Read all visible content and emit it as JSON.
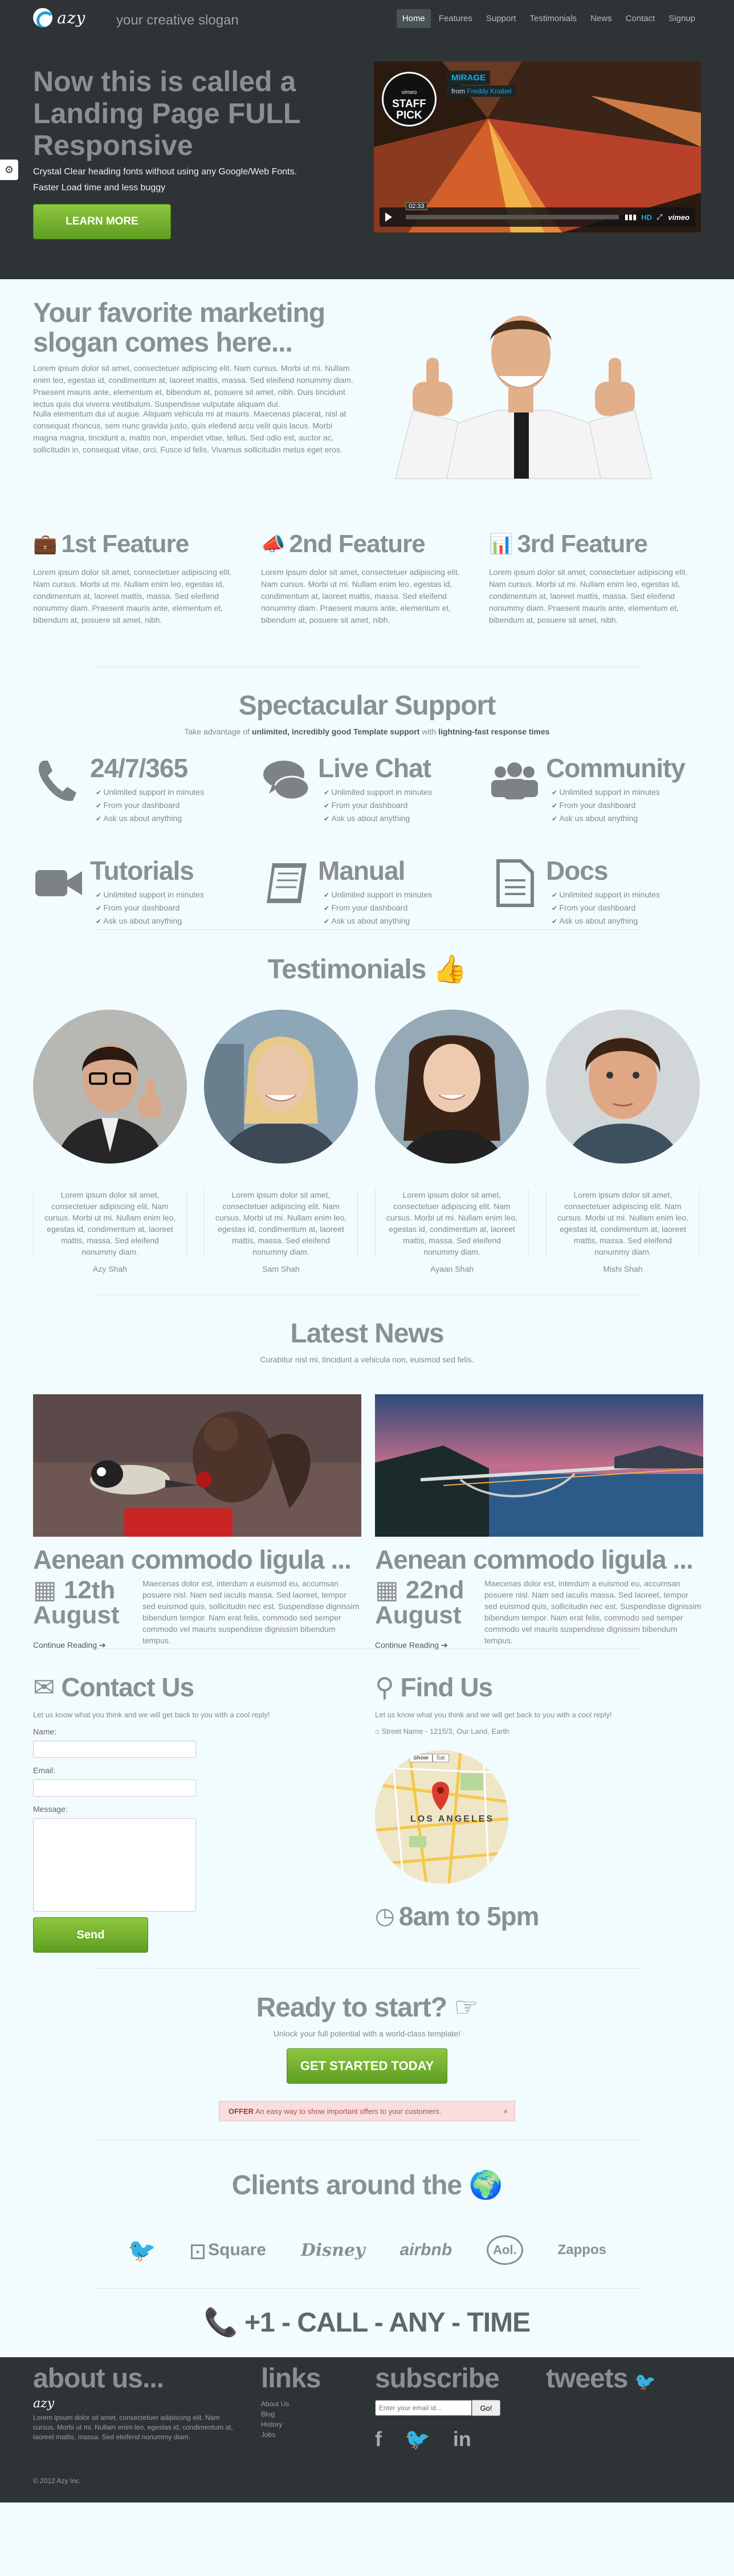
{
  "header": {
    "logo_text": "azy",
    "slogan": "your creative slogan",
    "nav": [
      "Home",
      "Features",
      "Support",
      "Testimonials",
      "News",
      "Contact",
      "Signup"
    ],
    "hero_title": "Now this is called a Landing Page FULL Responsive",
    "hero_sub1": "Crystal Clear heading fonts without using any Google/Web Fonts.",
    "hero_sub2": "Faster Load time and less buggy",
    "learn_more": "LEARN MORE",
    "video": {
      "badge_line1": "STAFF",
      "badge_line2": "PICK",
      "badge_top": "vimeo",
      "title": "MIRAGE",
      "from": "from",
      "author": "Freddy Knabel",
      "time": "02:33",
      "hd": "HD",
      "brand": "vimeo"
    }
  },
  "marketing": {
    "title": "Your favorite marketing slogan comes here...",
    "p1": "Lorem ipsum dolor sit amet, consectetuer adipiscing elit. Nam cursus. Morbi ut mi. Nullam enim leo, egestas id, condimentum at, laoreet mattis, massa. Sed eleifend nonummy diam. Praesent mauris ante, elementum et, bibendum at, posuere sit amet, nibh. Duis tincidunt lectus quis dui viverra vestibulum. Suspendisse vulputate aliquam dui.",
    "p2": "Nulla elementum dui ut augue. Aliquam vehicula mi at mauris. Maecenas placerat, nisl at consequat rhoncus, sem nunc gravida justo, quis eleifend arcu velit quis lacus. Morbi magna magna, tincidunt a, mattis non, imperdiet vitae, tellus. Sed odio est, auctor ac, sollicitudin in, consequat vitae, orci. Fusce id felis. Vivamus sollicitudin metus eget eros."
  },
  "features": [
    {
      "icon": "briefcase-icon",
      "title": "1st Feature",
      "text": "Lorem ipsum dolor sit amet, consectetuer adipiscing elit. Nam cursus. Morbi ut mi. Nullam enim leo, egestas id, condimentum at, laoreet mattis, massa. Sed eleifend nonummy diam. Praesent mauris ante, elementum et, bibendum at, posuere sit amet, nibh."
    },
    {
      "icon": "bullhorn-icon",
      "title": "2nd Feature",
      "text": "Lorem ipsum dolor sit amet, consectetuer adipiscing elit. Nam cursus. Morbi ut mi. Nullam enim leo, egestas id, condimentum at, laoreet mattis, massa. Sed eleifend nonummy diam. Praesent mauris ante, elementum et, bibendum at, posuere sit amet, nibh."
    },
    {
      "icon": "bar-chart-icon",
      "title": "3rd Feature",
      "text": "Lorem ipsum dolor sit amet, consectetuer adipiscing elit. Nam cursus. Morbi ut mi. Nullam enim leo, egestas id, condimentum at, laoreet mattis, massa. Sed eleifend nonummy diam. Praesent mauris ante, elementum et, bibendum at, posuere sit amet, nibh."
    }
  ],
  "support": {
    "title": "Spectacular Support",
    "tag_pre": "Take advantage of ",
    "tag_b1": "unlimited, incredibly good Template support",
    "tag_mid": " with ",
    "tag_b2": "lightning-fast response times",
    "items": [
      {
        "icon": "phone-icon",
        "title": "24/7/365"
      },
      {
        "icon": "chat-icon",
        "title": "Live Chat"
      },
      {
        "icon": "group-icon",
        "title": "Community"
      },
      {
        "icon": "video-camera-icon",
        "title": "Tutorials"
      },
      {
        "icon": "book-icon",
        "title": "Manual"
      },
      {
        "icon": "document-icon",
        "title": "Docs"
      }
    ],
    "bullets": [
      "Unlimited support in minutes",
      "From your dashboard",
      "Ask us about anything"
    ]
  },
  "testimonials": {
    "title": "Testimonials",
    "quote": "Lorem ipsum dolor sit amet, consectetuer adipiscing elit. Nam cursus. Morbi ut mi. Nullam enim leo, egestas id, condimentum at, laoreet mattis, massa. Sed eleifend nonummy diam.",
    "names": [
      "Azy Shah",
      "Sam Shah",
      "Ayaan Shah",
      "Mishi Shah"
    ]
  },
  "news": {
    "title": "Latest News",
    "sub": "Curabitur nisl mi, tincidunt a vehicula non, euismod sed felis.",
    "items": [
      {
        "title": "Aenean commodo ligula ...",
        "day": "12th",
        "month": "August",
        "text": "Maecenas dolor est, interdum a euismod eu, accumsan posuere nisl. Nam sed iaculis massa. Sed laoreet, tempor sed euismod quis, sollicitudin nec est. Suspendisse dignissim bibendum tempor. Nam erat felis, commodo sed semper commodo vel mauris suspendisse dignissim bibendum tempus."
      },
      {
        "title": "Aenean commodo ligula ...",
        "day": "22nd",
        "month": "August",
        "text": "Maecenas dolor est, interdum a euismod eu, accumsan posuere nisl. Nam sed iaculis massa. Sed laoreet, tempor sed euismod quis, sollicitudin nec est. Suspendisse dignissim bibendum tempor. Nam erat felis, commodo sed semper commodo vel mauris suspendisse dignissim bibendum tempus."
      }
    ],
    "continue": "Continue Reading ➔"
  },
  "contact": {
    "title": "Contact Us",
    "sub": "Let us know what you think and we will get back to you with a cool reply!",
    "name_label": "Name:",
    "email_label": "Email:",
    "message_label": "Message:",
    "send": "Send"
  },
  "find": {
    "title": "Find Us",
    "sub": "Let us know what you think and we will get back to you with a cool reply!",
    "address": "Street Name - 1215/3, Our Land, Earth",
    "map_btn1": "Show",
    "map_btn2": "Sat",
    "map_city": "LOS ANGELES",
    "hours": "8am to 5pm"
  },
  "ready": {
    "title": "Ready to start?",
    "sub": "Unlock your full potential with a world-class template!",
    "button": "GET STARTED TODAY",
    "offer_b": "OFFER",
    "offer_text": " An easy way to show important offers to your customers.",
    "offer_close": "×"
  },
  "clients": {
    "title": "Clients around the",
    "logos": [
      "twitter",
      "Square",
      "Disney",
      "airbnb",
      "Aol.",
      "Zappos"
    ]
  },
  "call": {
    "text": "+1 - CALL - ANY - TIME"
  },
  "footer": {
    "about_title": "about us...",
    "about_logo": "azy",
    "about_text": "Lorem ipsum dolor sit amet, consectetuer adipiscing elit. Nam cursus. Morbi ut mi. Nullam enim leo, egestas id, condimentum at, laoreet mattis, massa. Sed eleifend nonummy diam.",
    "copyright": "© 2012 Azy Inc.",
    "links_title": "links",
    "links": [
      "About Us",
      "Blog",
      "History",
      "Jobs"
    ],
    "subscribe_title": "subscribe",
    "email_placeholder": "Enter your email id...",
    "go": "Go!",
    "tweets_title": "tweets"
  }
}
